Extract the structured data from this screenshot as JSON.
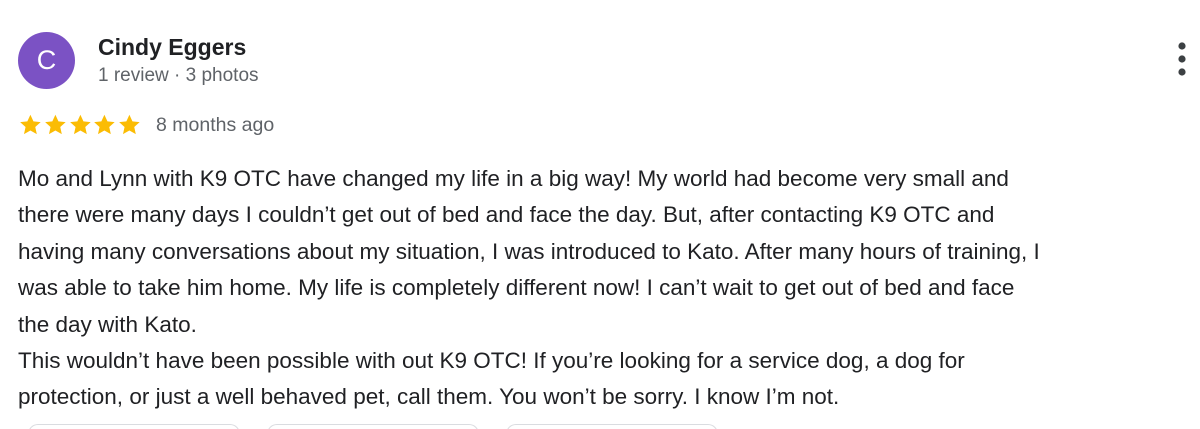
{
  "reviewer": {
    "initial": "C",
    "name": "Cindy Eggers",
    "meta": "1 review · 3 photos"
  },
  "rating": {
    "stars": 5,
    "max": 5,
    "star_color": "#fbbc04",
    "date": "8 months ago"
  },
  "review": {
    "lines": [
      "Mo and Lynn with K9 OTC have changed my life in a big way! My world had become very small and",
      "there were many days I couldn’t get out of bed and face the day. But, after contacting K9 OTC and",
      "having many conversations about my situation, I was introduced to Kato. After many hours of training, I",
      "was able to take him home. My life is completely different now! I can’t wait to get out of bed and face",
      "the day with Kato.",
      "This wouldn’t have been possible with out K9 OTC! If you’re looking for a service dog, a dog for",
      "protection, or just a well behaved pet, call them. You won’t be sorry. I know I’m not."
    ]
  },
  "colors": {
    "avatar_bg": "#7b52c4",
    "name_text": "#202124",
    "meta_text": "#5f6368"
  },
  "icons": {
    "menu": "more-vert-icon",
    "star": "star-icon"
  }
}
